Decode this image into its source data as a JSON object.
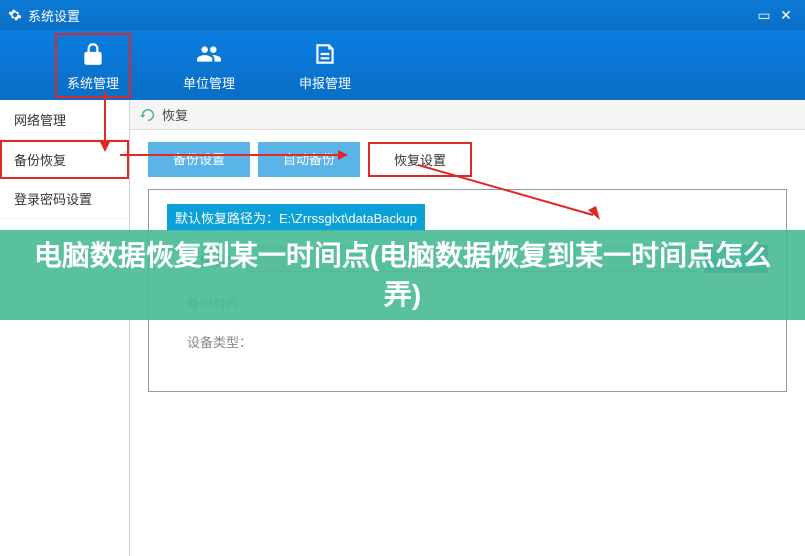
{
  "window": {
    "title": "系统设置"
  },
  "topnav": {
    "items": [
      {
        "label": "系统管理",
        "active": true
      },
      {
        "label": "单位管理"
      },
      {
        "label": "申报管理"
      }
    ]
  },
  "sidebar": {
    "items": [
      {
        "label": "网络管理"
      },
      {
        "label": "备份恢复",
        "active": true
      },
      {
        "label": "登录密码设置"
      }
    ]
  },
  "breadcrumb": {
    "label": "恢复"
  },
  "tabs": {
    "items": [
      {
        "label": "备份设置",
        "style": "blue"
      },
      {
        "label": "自动备份",
        "style": "blue"
      },
      {
        "label": "恢复设置",
        "style": "active"
      }
    ]
  },
  "panel": {
    "path_banner": "默认恢复路径为：E:\\Zrrssglxt\\dataBackup",
    "file_label": "文件名：",
    "file_value": "",
    "select_btn": "选择...",
    "backup_time_label": "备份时间：",
    "device_type_label": "设备类型："
  },
  "overlay": {
    "text": "电脑数据恢复到某一时间点(电脑数据恢复到某一时间点怎么弄)"
  }
}
